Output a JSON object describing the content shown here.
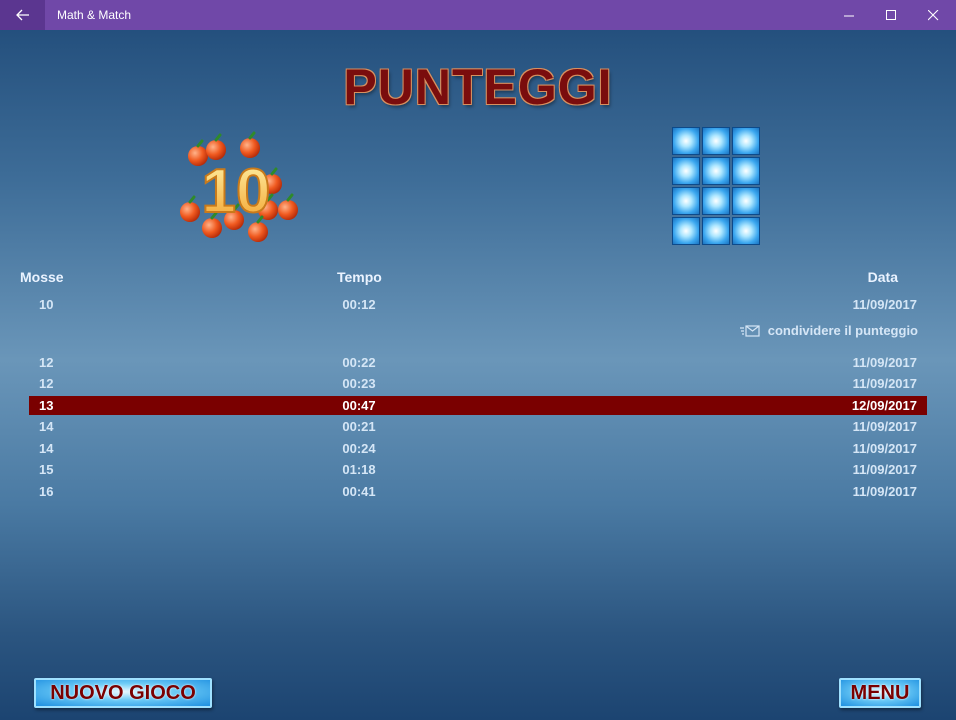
{
  "window": {
    "app_title": "Math & Match"
  },
  "page": {
    "title": "PUNTEGGI"
  },
  "badge": {
    "number": "10"
  },
  "table": {
    "headers": {
      "moves": "Mosse",
      "time": "Tempo",
      "date": "Data"
    },
    "rows": [
      {
        "moves": "10",
        "time": "00:12",
        "date": "11/09/2017"
      },
      {
        "moves": "12",
        "time": "00:22",
        "date": "11/09/2017"
      },
      {
        "moves": "12",
        "time": "00:23",
        "date": "11/09/2017"
      },
      {
        "moves": "13",
        "time": "00:47",
        "date": "12/09/2017"
      },
      {
        "moves": "14",
        "time": "00:21",
        "date": "11/09/2017"
      },
      {
        "moves": "14",
        "time": "00:24",
        "date": "11/09/2017"
      },
      {
        "moves": "15",
        "time": "01:18",
        "date": "11/09/2017"
      },
      {
        "moves": "16",
        "time": "00:41",
        "date": "11/09/2017"
      }
    ],
    "share_label": "condividere il punteggio",
    "share_icon": "mail-send-icon"
  },
  "buttons": {
    "new_game": "NUOVO GIOCO",
    "menu": "MENU"
  },
  "colors": {
    "titlebar": "#7048a8",
    "highlight_row": "#7a0000",
    "title_text": "#7a0d0d"
  }
}
